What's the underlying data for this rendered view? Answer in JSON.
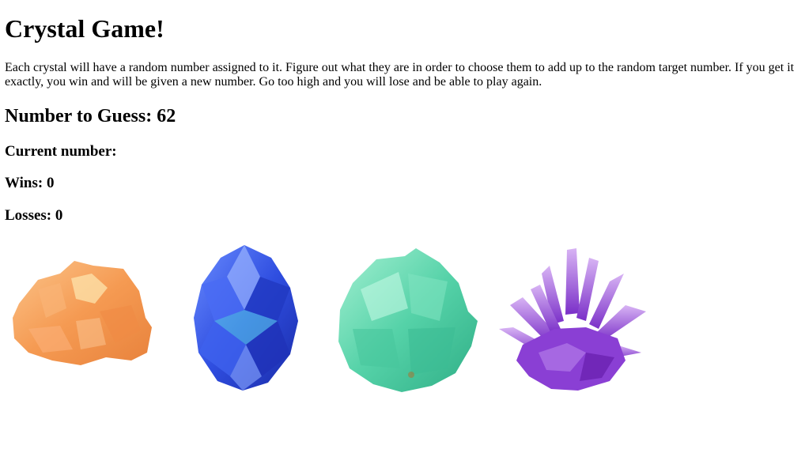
{
  "game": {
    "title": "Crystal Game!",
    "instructions": "Each crystal will have a random number assigned to it. Figure out what they are in order to choose them to add up to the random target number. If you get it exactly, you win and will be given a new number. Go too high and you will lose and be able to play again.",
    "target_label": "Number to Guess: 62",
    "current_label": "Current number:",
    "wins_label": "Wins: 0",
    "losses_label": "Losses: 0"
  },
  "crystals": [
    {
      "name": "orange-crystal-icon",
      "color": "#f5a05a"
    },
    {
      "name": "blue-crystal-icon",
      "color": "#3a5ae8"
    },
    {
      "name": "green-crystal-icon",
      "color": "#55d2a8"
    },
    {
      "name": "purple-crystal-icon",
      "color": "#9a55d8"
    }
  ]
}
